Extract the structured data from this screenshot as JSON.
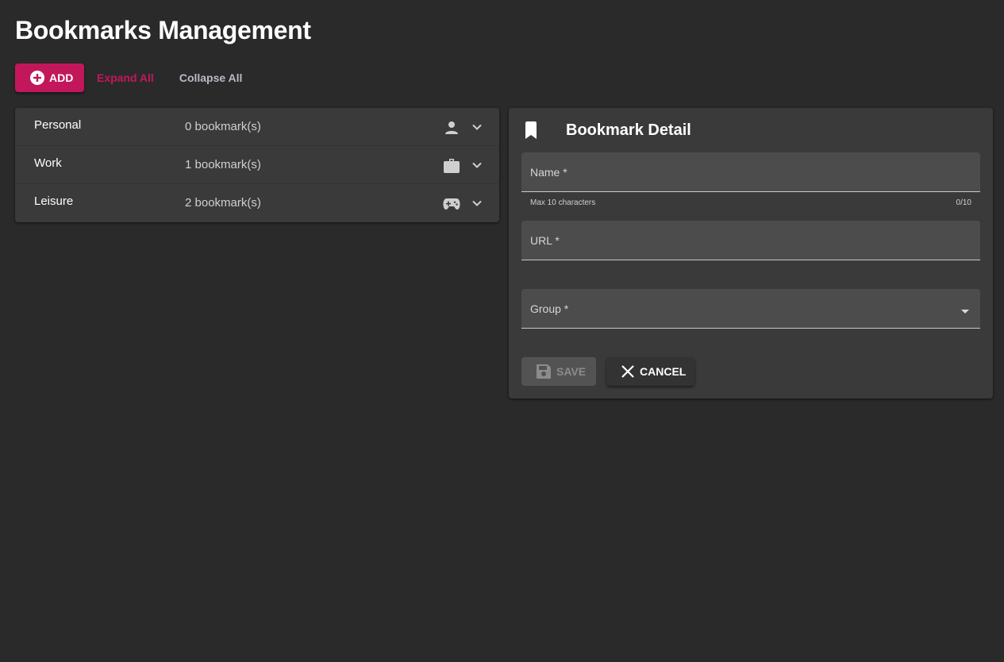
{
  "page": {
    "title": "Bookmarks Management"
  },
  "toolbar": {
    "add_label": "ADD",
    "expand_all_label": "Expand All",
    "collapse_all_label": "Collapse All"
  },
  "groups": [
    {
      "name": "Personal",
      "count": "0 bookmark(s)",
      "icon": "person-icon"
    },
    {
      "name": "Work",
      "count": "1 bookmark(s)",
      "icon": "briefcase-icon"
    },
    {
      "name": "Leisure",
      "count": "2 bookmark(s)",
      "icon": "gamepad-icon"
    }
  ],
  "detail": {
    "title": "Bookmark Detail",
    "name_label": "Name *",
    "name_hint": "Max 10 characters",
    "name_counter": "0/10",
    "url_label": "URL *",
    "group_label": "Group *",
    "save_label": "SAVE",
    "cancel_label": "CANCEL"
  },
  "colors": {
    "accent": "#c2185b",
    "background": "#2a2a2a",
    "panel": "#3a3a3a"
  }
}
